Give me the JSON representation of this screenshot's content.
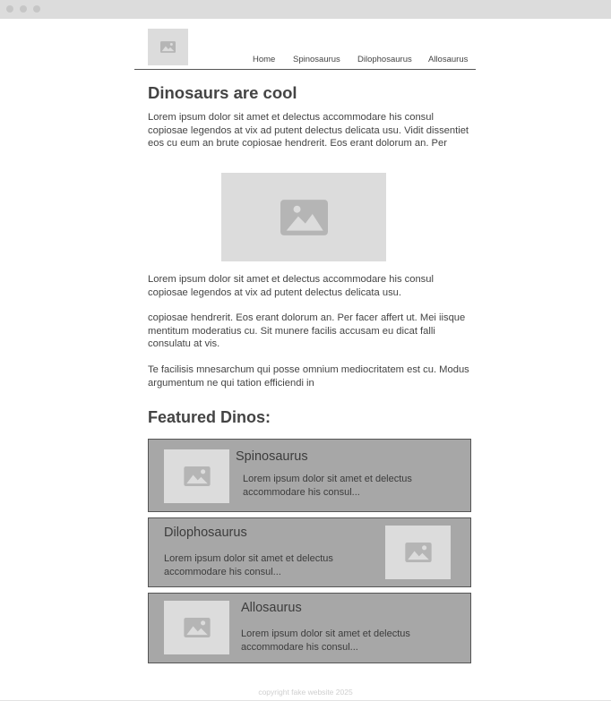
{
  "window": {
    "controls": [
      "close",
      "minimize",
      "maximize"
    ]
  },
  "header": {
    "logo_icon": "image-placeholder-icon",
    "nav": [
      "Home",
      "Spinosaurus",
      "Dilophosaurus",
      "Allosaurus"
    ]
  },
  "main": {
    "title": "Dinosaurs are cool",
    "intro": "Lorem ipsum dolor sit amet et delectus accommodare his consul copiosae legendos at vix ad putent delectus delicata usu. Vidit dissentiet eos cu eum an brute copiosae hendrerit. Eos erant dolorum an. Per",
    "hero_icon": "image-placeholder-icon",
    "paragraphs": [
      "Lorem ipsum dolor sit amet et delectus accommodare his consul copiosae legendos at vix ad putent delectus delicata usu.",
      "copiosae hendrerit. Eos erant dolorum an. Per facer affert ut. Mei iisque mentitum moderatius cu. Sit munere facilis accusam eu dicat falli consulatu at vis.",
      "Te facilisis mnesarchum qui posse omnium mediocritatem est cu. Modus argumentum ne qui tation efficiendi in"
    ]
  },
  "featured": {
    "title": "Featured Dinos:",
    "cards": [
      {
        "name": "Spinosaurus",
        "text": "Lorem ipsum dolor sit amet et delectus accommodare his consul..."
      },
      {
        "name": "Dilophosaurus",
        "text": "Lorem ipsum dolor sit amet et delectus accommodare his consul..."
      },
      {
        "name": "Allosaurus",
        "text": "Lorem ipsum dolor sit amet et delectus accommodare his consul..."
      }
    ]
  },
  "footer": {
    "text": "copyright fake website 2025"
  },
  "colors": {
    "placeholder": "#dcdcdc",
    "card": "#a7a7a7",
    "text": "#444444",
    "titlebar": "#dcdcdc"
  }
}
